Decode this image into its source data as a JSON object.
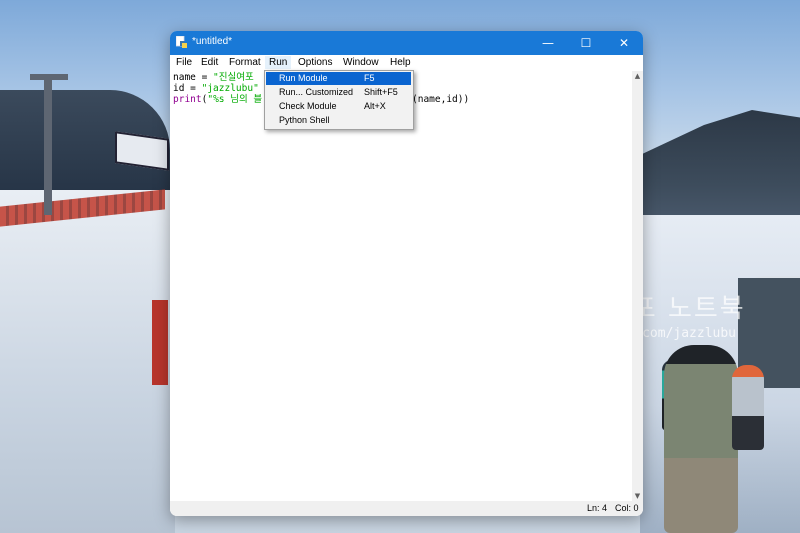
{
  "window": {
    "title": "*untitled*",
    "controls": {
      "minimize": "—",
      "maximize": "☐",
      "close": "✕"
    }
  },
  "menubar": [
    "File",
    "Edit",
    "Format",
    "Run",
    "Options",
    "Window",
    "Help"
  ],
  "active_menu": "Run",
  "run_menu": [
    {
      "label": "Run Module",
      "shortcut": "F5",
      "selected": true
    },
    {
      "label": "Run... Customized",
      "shortcut": "Shift+F5"
    },
    {
      "label": "Check Module",
      "shortcut": "Alt+X"
    },
    {
      "label": "Python Shell",
      "shortcut": ""
    }
  ],
  "code": {
    "line1": {
      "a": "name = ",
      "b": "\"진실여포"
    },
    "line2": {
      "a": "id = ",
      "b": "\"jazzlubu\""
    },
    "line3": {
      "a": "print",
      "b": "(",
      "c": "\"%s 님의 블",
      "d": "(name,id))"
    }
  },
  "status": {
    "line": "Ln: 4",
    "col": "Col: 0"
  },
  "watermark": {
    "title": "진실여포 노트북",
    "url": "blog.naver.com/jazzlubu"
  },
  "colors": {
    "titlebar": "#1979d7",
    "menu_selected": "#0a64d0",
    "string": "#00aa00",
    "builtin": "#900090"
  }
}
